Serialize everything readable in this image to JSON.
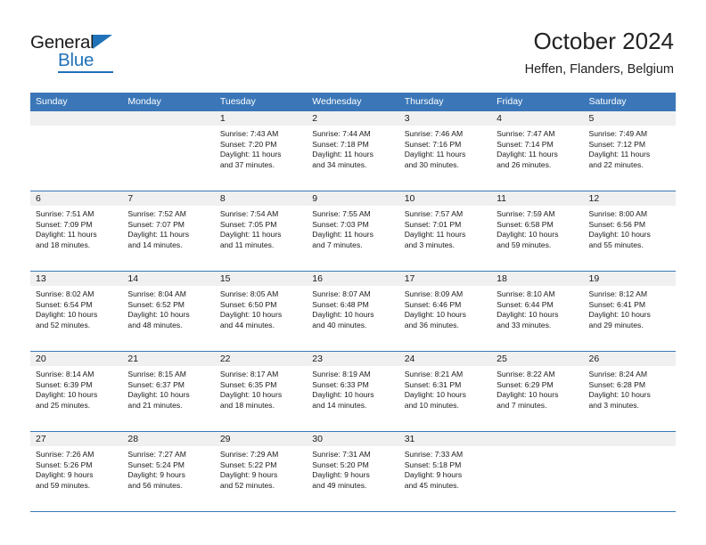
{
  "brand": {
    "name_line1": "General",
    "name_line2": "Blue",
    "triangle_icon": "blue-triangle-icon",
    "color_primary": "#1f72b8"
  },
  "header": {
    "title": "October 2024",
    "subtitle": "Heffen, Flanders, Belgium"
  },
  "theme": {
    "header_row_bg": "#3b77b8",
    "date_band_bg": "#f0f0f0",
    "grid_line": "#3b77b8",
    "text": "#1a1a1a"
  },
  "weekdays": [
    "Sunday",
    "Monday",
    "Tuesday",
    "Wednesday",
    "Thursday",
    "Friday",
    "Saturday"
  ],
  "weeks": [
    [
      {
        "day": "",
        "sunrise": "",
        "sunset": "",
        "daylight_line1": "",
        "daylight_line2": ""
      },
      {
        "day": "",
        "sunrise": "",
        "sunset": "",
        "daylight_line1": "",
        "daylight_line2": ""
      },
      {
        "day": "1",
        "sunrise": "Sunrise: 7:43 AM",
        "sunset": "Sunset: 7:20 PM",
        "daylight_line1": "Daylight: 11 hours",
        "daylight_line2": "and 37 minutes."
      },
      {
        "day": "2",
        "sunrise": "Sunrise: 7:44 AM",
        "sunset": "Sunset: 7:18 PM",
        "daylight_line1": "Daylight: 11 hours",
        "daylight_line2": "and 34 minutes."
      },
      {
        "day": "3",
        "sunrise": "Sunrise: 7:46 AM",
        "sunset": "Sunset: 7:16 PM",
        "daylight_line1": "Daylight: 11 hours",
        "daylight_line2": "and 30 minutes."
      },
      {
        "day": "4",
        "sunrise": "Sunrise: 7:47 AM",
        "sunset": "Sunset: 7:14 PM",
        "daylight_line1": "Daylight: 11 hours",
        "daylight_line2": "and 26 minutes."
      },
      {
        "day": "5",
        "sunrise": "Sunrise: 7:49 AM",
        "sunset": "Sunset: 7:12 PM",
        "daylight_line1": "Daylight: 11 hours",
        "daylight_line2": "and 22 minutes."
      }
    ],
    [
      {
        "day": "6",
        "sunrise": "Sunrise: 7:51 AM",
        "sunset": "Sunset: 7:09 PM",
        "daylight_line1": "Daylight: 11 hours",
        "daylight_line2": "and 18 minutes."
      },
      {
        "day": "7",
        "sunrise": "Sunrise: 7:52 AM",
        "sunset": "Sunset: 7:07 PM",
        "daylight_line1": "Daylight: 11 hours",
        "daylight_line2": "and 14 minutes."
      },
      {
        "day": "8",
        "sunrise": "Sunrise: 7:54 AM",
        "sunset": "Sunset: 7:05 PM",
        "daylight_line1": "Daylight: 11 hours",
        "daylight_line2": "and 11 minutes."
      },
      {
        "day": "9",
        "sunrise": "Sunrise: 7:55 AM",
        "sunset": "Sunset: 7:03 PM",
        "daylight_line1": "Daylight: 11 hours",
        "daylight_line2": "and 7 minutes."
      },
      {
        "day": "10",
        "sunrise": "Sunrise: 7:57 AM",
        "sunset": "Sunset: 7:01 PM",
        "daylight_line1": "Daylight: 11 hours",
        "daylight_line2": "and 3 minutes."
      },
      {
        "day": "11",
        "sunrise": "Sunrise: 7:59 AM",
        "sunset": "Sunset: 6:58 PM",
        "daylight_line1": "Daylight: 10 hours",
        "daylight_line2": "and 59 minutes."
      },
      {
        "day": "12",
        "sunrise": "Sunrise: 8:00 AM",
        "sunset": "Sunset: 6:56 PM",
        "daylight_line1": "Daylight: 10 hours",
        "daylight_line2": "and 55 minutes."
      }
    ],
    [
      {
        "day": "13",
        "sunrise": "Sunrise: 8:02 AM",
        "sunset": "Sunset: 6:54 PM",
        "daylight_line1": "Daylight: 10 hours",
        "daylight_line2": "and 52 minutes."
      },
      {
        "day": "14",
        "sunrise": "Sunrise: 8:04 AM",
        "sunset": "Sunset: 6:52 PM",
        "daylight_line1": "Daylight: 10 hours",
        "daylight_line2": "and 48 minutes."
      },
      {
        "day": "15",
        "sunrise": "Sunrise: 8:05 AM",
        "sunset": "Sunset: 6:50 PM",
        "daylight_line1": "Daylight: 10 hours",
        "daylight_line2": "and 44 minutes."
      },
      {
        "day": "16",
        "sunrise": "Sunrise: 8:07 AM",
        "sunset": "Sunset: 6:48 PM",
        "daylight_line1": "Daylight: 10 hours",
        "daylight_line2": "and 40 minutes."
      },
      {
        "day": "17",
        "sunrise": "Sunrise: 8:09 AM",
        "sunset": "Sunset: 6:46 PM",
        "daylight_line1": "Daylight: 10 hours",
        "daylight_line2": "and 36 minutes."
      },
      {
        "day": "18",
        "sunrise": "Sunrise: 8:10 AM",
        "sunset": "Sunset: 6:44 PM",
        "daylight_line1": "Daylight: 10 hours",
        "daylight_line2": "and 33 minutes."
      },
      {
        "day": "19",
        "sunrise": "Sunrise: 8:12 AM",
        "sunset": "Sunset: 6:41 PM",
        "daylight_line1": "Daylight: 10 hours",
        "daylight_line2": "and 29 minutes."
      }
    ],
    [
      {
        "day": "20",
        "sunrise": "Sunrise: 8:14 AM",
        "sunset": "Sunset: 6:39 PM",
        "daylight_line1": "Daylight: 10 hours",
        "daylight_line2": "and 25 minutes."
      },
      {
        "day": "21",
        "sunrise": "Sunrise: 8:15 AM",
        "sunset": "Sunset: 6:37 PM",
        "daylight_line1": "Daylight: 10 hours",
        "daylight_line2": "and 21 minutes."
      },
      {
        "day": "22",
        "sunrise": "Sunrise: 8:17 AM",
        "sunset": "Sunset: 6:35 PM",
        "daylight_line1": "Daylight: 10 hours",
        "daylight_line2": "and 18 minutes."
      },
      {
        "day": "23",
        "sunrise": "Sunrise: 8:19 AM",
        "sunset": "Sunset: 6:33 PM",
        "daylight_line1": "Daylight: 10 hours",
        "daylight_line2": "and 14 minutes."
      },
      {
        "day": "24",
        "sunrise": "Sunrise: 8:21 AM",
        "sunset": "Sunset: 6:31 PM",
        "daylight_line1": "Daylight: 10 hours",
        "daylight_line2": "and 10 minutes."
      },
      {
        "day": "25",
        "sunrise": "Sunrise: 8:22 AM",
        "sunset": "Sunset: 6:29 PM",
        "daylight_line1": "Daylight: 10 hours",
        "daylight_line2": "and 7 minutes."
      },
      {
        "day": "26",
        "sunrise": "Sunrise: 8:24 AM",
        "sunset": "Sunset: 6:28 PM",
        "daylight_line1": "Daylight: 10 hours",
        "daylight_line2": "and 3 minutes."
      }
    ],
    [
      {
        "day": "27",
        "sunrise": "Sunrise: 7:26 AM",
        "sunset": "Sunset: 5:26 PM",
        "daylight_line1": "Daylight: 9 hours",
        "daylight_line2": "and 59 minutes."
      },
      {
        "day": "28",
        "sunrise": "Sunrise: 7:27 AM",
        "sunset": "Sunset: 5:24 PM",
        "daylight_line1": "Daylight: 9 hours",
        "daylight_line2": "and 56 minutes."
      },
      {
        "day": "29",
        "sunrise": "Sunrise: 7:29 AM",
        "sunset": "Sunset: 5:22 PM",
        "daylight_line1": "Daylight: 9 hours",
        "daylight_line2": "and 52 minutes."
      },
      {
        "day": "30",
        "sunrise": "Sunrise: 7:31 AM",
        "sunset": "Sunset: 5:20 PM",
        "daylight_line1": "Daylight: 9 hours",
        "daylight_line2": "and 49 minutes."
      },
      {
        "day": "31",
        "sunrise": "Sunrise: 7:33 AM",
        "sunset": "Sunset: 5:18 PM",
        "daylight_line1": "Daylight: 9 hours",
        "daylight_line2": "and 45 minutes."
      },
      {
        "day": "",
        "sunrise": "",
        "sunset": "",
        "daylight_line1": "",
        "daylight_line2": ""
      },
      {
        "day": "",
        "sunrise": "",
        "sunset": "",
        "daylight_line1": "",
        "daylight_line2": ""
      }
    ]
  ]
}
